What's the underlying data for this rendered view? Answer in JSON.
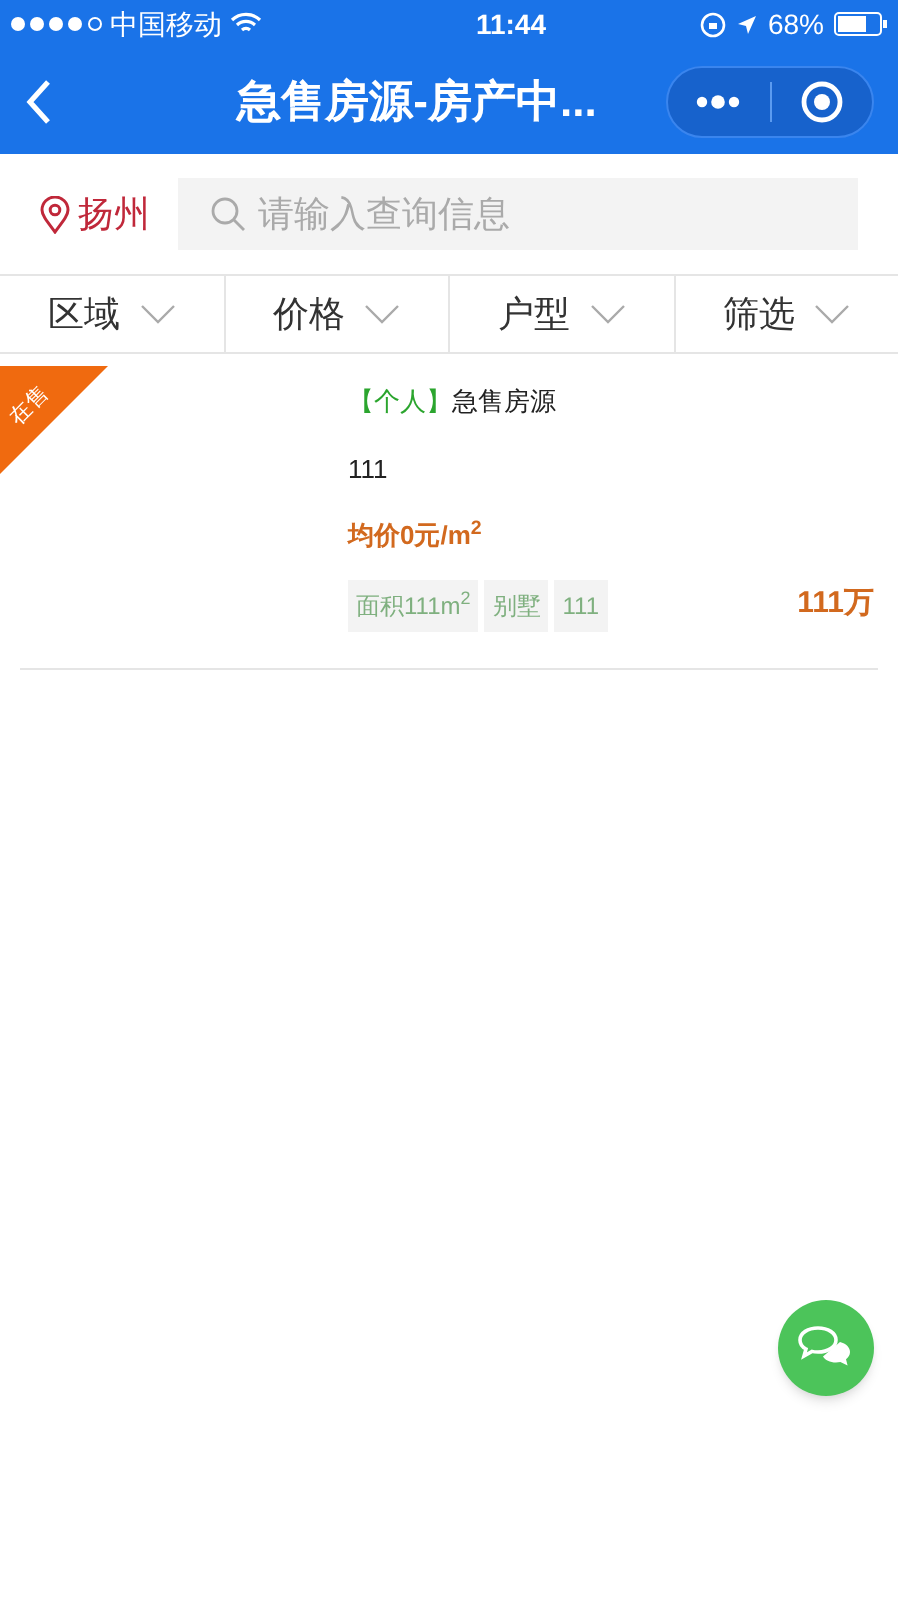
{
  "status_bar": {
    "carrier": "中国移动",
    "time": "11:44",
    "battery": "68%"
  },
  "nav": {
    "title": "急售房源-房产中..."
  },
  "search": {
    "city": "扬州",
    "placeholder": "请输入查询信息"
  },
  "filters": [
    {
      "label": "区域"
    },
    {
      "label": "价格"
    },
    {
      "label": "户型"
    },
    {
      "label": "筛选"
    }
  ],
  "listings": [
    {
      "ribbon": "在售",
      "tag": "【个人】",
      "title": "急售房源",
      "subtitle": "111",
      "avg_price": "均价0元/m$^{2}$",
      "chips": [
        "面积111m$^{2}$",
        "别墅",
        "111"
      ],
      "price": "111万"
    }
  ]
}
